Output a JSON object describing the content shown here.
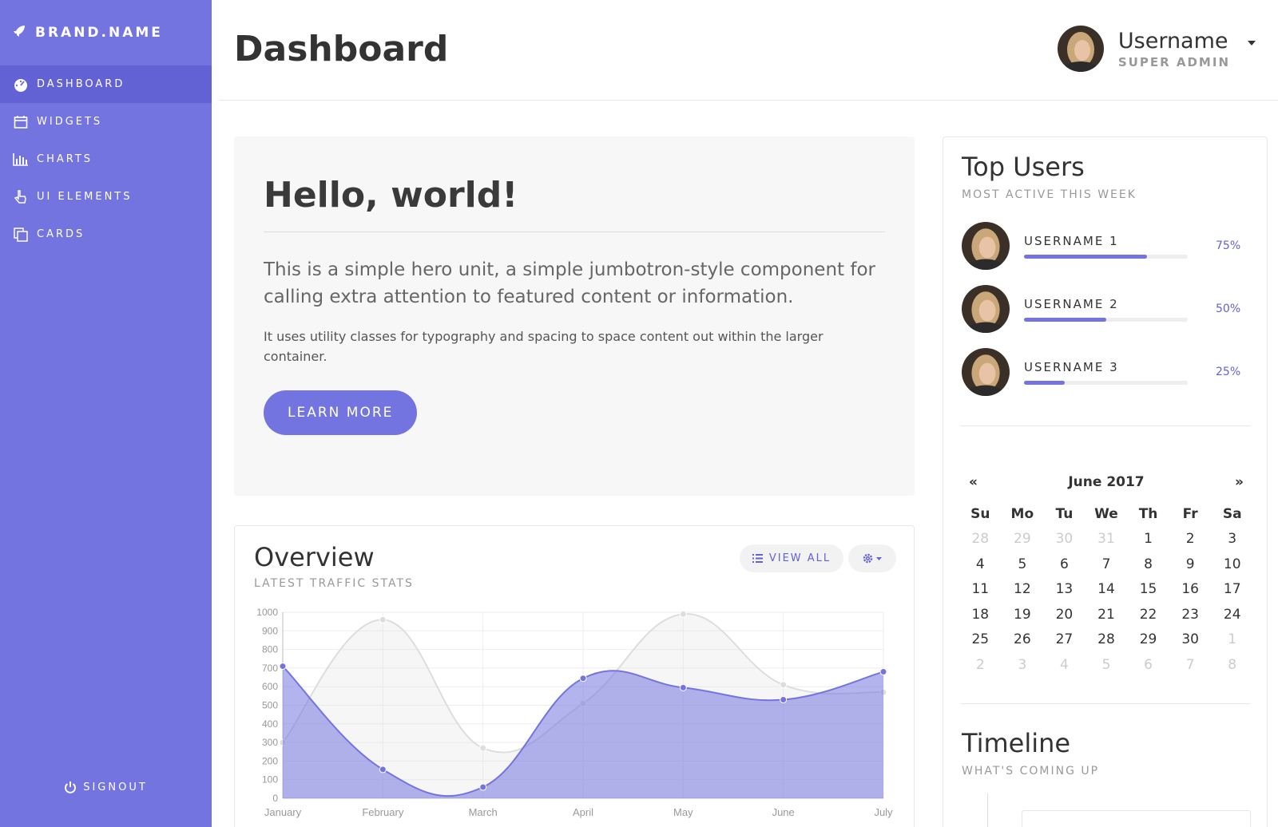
{
  "brand": {
    "name": "BRAND.NAME",
    "icon": "rocket-icon"
  },
  "sidebar": {
    "items": [
      {
        "label": "DASHBOARD",
        "icon": "dashboard-icon",
        "active": true
      },
      {
        "label": "WIDGETS",
        "icon": "calendar-icon",
        "active": false
      },
      {
        "label": "CHARTS",
        "icon": "bar-chart-icon",
        "active": false
      },
      {
        "label": "UI ELEMENTS",
        "icon": "hand-pointer-icon",
        "active": false
      },
      {
        "label": "CARDS",
        "icon": "copy-icon",
        "active": false
      }
    ],
    "signout": "SIGNOUT"
  },
  "header": {
    "title": "Dashboard",
    "user": {
      "name": "Username",
      "role": "SUPER ADMIN"
    }
  },
  "jumbotron": {
    "title": "Hello, world!",
    "lead": "This is a simple hero unit, a simple jumbotron-style component for calling extra attention to featured content or information.",
    "text": "It uses utility classes for typography and spacing to space content out within the larger container.",
    "button": "LEARN MORE"
  },
  "overview": {
    "title": "Overview",
    "subtitle": "LATEST TRAFFIC STATS",
    "view_all": "VIEW ALL"
  },
  "chart_data": {
    "type": "area",
    "categories": [
      "January",
      "February",
      "March",
      "April",
      "May",
      "June",
      "July"
    ],
    "ylim": [
      0,
      1000
    ],
    "yticks": [
      0,
      100,
      200,
      300,
      400,
      500,
      600,
      700,
      800,
      900,
      1000
    ],
    "grid": true,
    "series": [
      {
        "values": [
          300,
          960,
          270,
          510,
          990,
          610,
          570
        ],
        "color": "#dcdcdc"
      },
      {
        "values": [
          710,
          155,
          60,
          645,
          595,
          530,
          680
        ],
        "color": "#7474e0"
      }
    ]
  },
  "top_users": {
    "title": "Top Users",
    "subtitle": "MOST ACTIVE THIS WEEK",
    "users": [
      {
        "name": "USERNAME 1",
        "percent": 75,
        "label": "75%"
      },
      {
        "name": "USERNAME 2",
        "percent": 50,
        "label": "50%"
      },
      {
        "name": "USERNAME 3",
        "percent": 25,
        "label": "25%"
      }
    ]
  },
  "calendar": {
    "title": "June 2017",
    "prev": "«",
    "next": "»",
    "days": [
      "Su",
      "Mo",
      "Tu",
      "We",
      "Th",
      "Fr",
      "Sa"
    ],
    "weeks": [
      [
        [
          "28",
          1
        ],
        [
          "29",
          1
        ],
        [
          "30",
          1
        ],
        [
          "31",
          1
        ],
        [
          "1",
          0
        ],
        [
          "2",
          0
        ],
        [
          "3",
          0
        ]
      ],
      [
        [
          "4",
          0
        ],
        [
          "5",
          0
        ],
        [
          "6",
          0
        ],
        [
          "7",
          0
        ],
        [
          "8",
          0
        ],
        [
          "9",
          0
        ],
        [
          "10",
          0
        ]
      ],
      [
        [
          "11",
          0
        ],
        [
          "12",
          0
        ],
        [
          "13",
          0
        ],
        [
          "14",
          0
        ],
        [
          "15",
          0
        ],
        [
          "16",
          0
        ],
        [
          "17",
          0
        ]
      ],
      [
        [
          "18",
          0
        ],
        [
          "19",
          0
        ],
        [
          "20",
          0
        ],
        [
          "21",
          0
        ],
        [
          "22",
          0
        ],
        [
          "23",
          0
        ],
        [
          "24",
          0
        ]
      ],
      [
        [
          "25",
          0
        ],
        [
          "26",
          0
        ],
        [
          "27",
          0
        ],
        [
          "28",
          0
        ],
        [
          "29",
          0
        ],
        [
          "30",
          0
        ],
        [
          "1",
          1
        ]
      ],
      [
        [
          "2",
          1
        ],
        [
          "3",
          1
        ],
        [
          "4",
          1
        ],
        [
          "5",
          1
        ],
        [
          "6",
          1
        ],
        [
          "7",
          1
        ],
        [
          "8",
          1
        ]
      ]
    ]
  },
  "timeline": {
    "title": "Timeline",
    "subtitle": "WHAT'S COMING UP"
  },
  "colors": {
    "accent": "#7474e0",
    "accent_dark": "#6262d4"
  }
}
